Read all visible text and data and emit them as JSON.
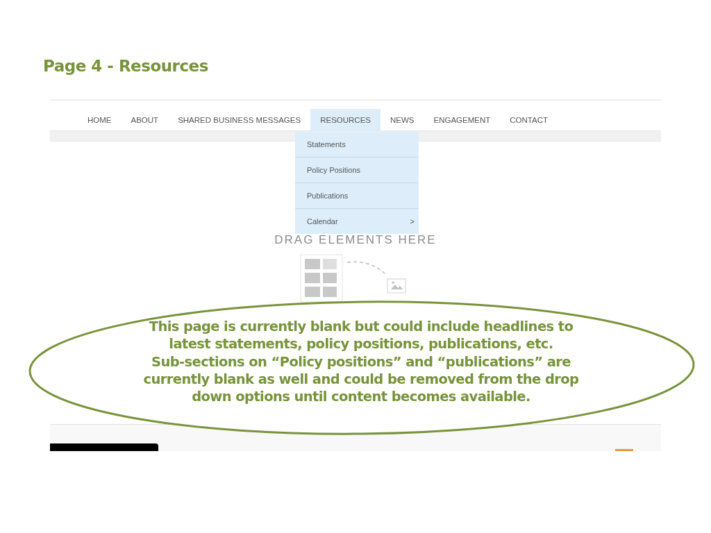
{
  "slide_title": "Page 4 - Resources",
  "nav": {
    "items": [
      {
        "label": "HOME",
        "selected": false
      },
      {
        "label": "ABOUT",
        "selected": false
      },
      {
        "label": "SHARED BUSINESS MESSAGES",
        "selected": false
      },
      {
        "label": "RESOURCES",
        "selected": true
      },
      {
        "label": "NEWS",
        "selected": false
      },
      {
        "label": "ENGAGEMENT",
        "selected": false
      },
      {
        "label": "CONTACT",
        "selected": false
      }
    ]
  },
  "dropdown": {
    "items": [
      {
        "label": "Statements"
      },
      {
        "label": "Policy Positions"
      },
      {
        "label": "Publications"
      },
      {
        "label": "Calendar",
        "submenu": ">"
      }
    ]
  },
  "drop_zone": {
    "hint": "DRAG ELEMENTS HERE"
  },
  "callout": {
    "text": "This page is currently blank but could include headlines to\nlatest statements, policy positions, publications, etc.\nSub-sections on “Policy positions” and “publications” are\ncurrently blank as well and could be removed from the drop\ndown options until content becomes available."
  }
}
